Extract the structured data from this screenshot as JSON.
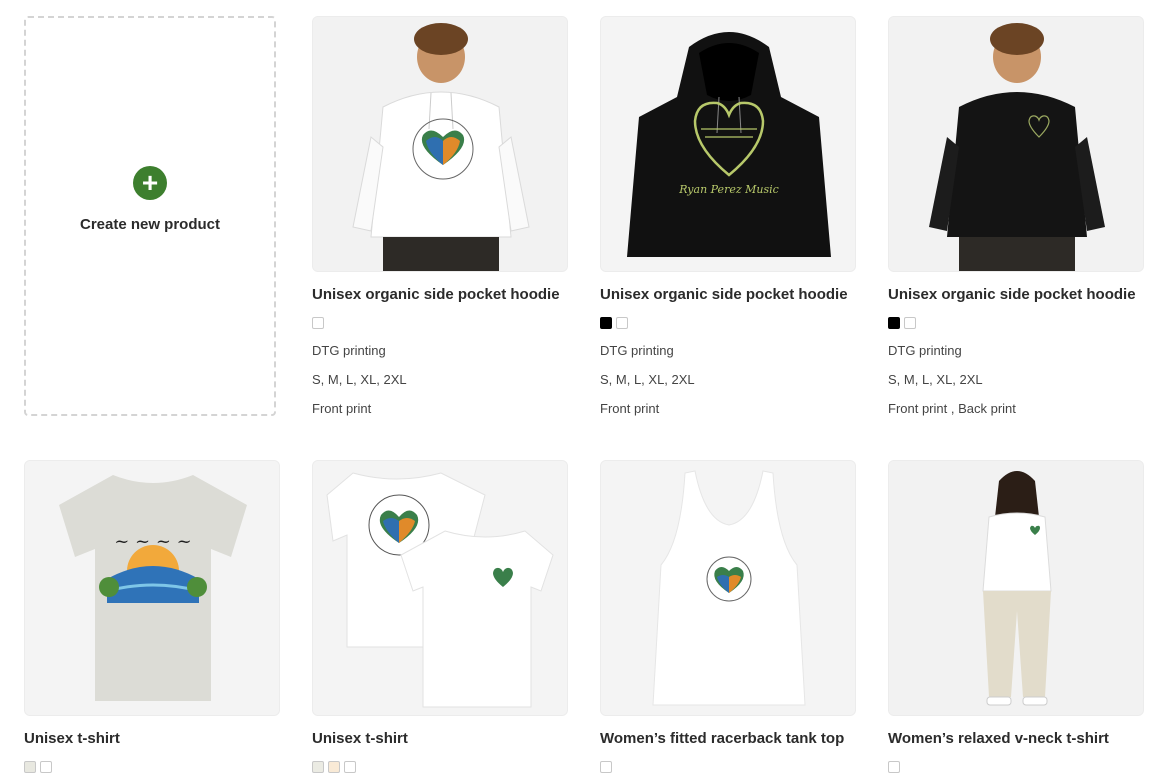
{
  "create": {
    "label": "Create new product",
    "icon": "plus-icon"
  },
  "products": [
    {
      "title": "Unisex organic side pocket hoodie",
      "swatches": [
        "#ffffff"
      ],
      "printing": "DTG printing",
      "sizes": "S, M, L, XL, 2XL",
      "placement": "Front print",
      "image": {
        "type": "hoodie-model",
        "garment": "#ffffff",
        "bg": "#f2f2f2"
      }
    },
    {
      "title": "Unisex organic side pocket hoodie",
      "swatches": [
        "#000000",
        "#ffffff"
      ],
      "printing": "DTG printing",
      "sizes": "S, M, L, XL, 2XL",
      "placement": "Front print",
      "image": {
        "type": "hoodie-flat",
        "garment": "#111111",
        "bg": "#f4f4f4",
        "graphic_text": "Ryan Perez Music"
      }
    },
    {
      "title": "Unisex organic side pocket hoodie",
      "swatches": [
        "#000000",
        "#ffffff"
      ],
      "printing": "DTG printing",
      "sizes": "S, M, L, XL, 2XL",
      "placement": "Front print , Back print",
      "image": {
        "type": "hoodie-model",
        "garment": "#141414",
        "bg": "#f2f2f2"
      }
    },
    {
      "title": "Unisex t-shirt",
      "swatches": [
        "#e8e8e0",
        "#ffffff"
      ],
      "image": {
        "type": "tee-flat",
        "garment": "#d9d9d4",
        "bg": "#f4f4f4"
      }
    },
    {
      "title": "Unisex t-shirt",
      "swatches": [
        "#ebebe3",
        "#f9ead6",
        "#ffffff"
      ],
      "image": {
        "type": "tee-pair",
        "garment": "#ffffff",
        "bg": "#f4f4f4"
      }
    },
    {
      "title": "Women’s fitted racerback tank top",
      "swatches": [
        "#ffffff"
      ],
      "image": {
        "type": "tank",
        "garment": "#ffffff",
        "bg": "#f4f4f4"
      }
    },
    {
      "title": "Women’s relaxed v-neck t-shirt",
      "swatches": [
        "#ffffff"
      ],
      "image": {
        "type": "model-woman",
        "garment": "#ffffff",
        "bg": "#f2f2f2"
      }
    }
  ]
}
